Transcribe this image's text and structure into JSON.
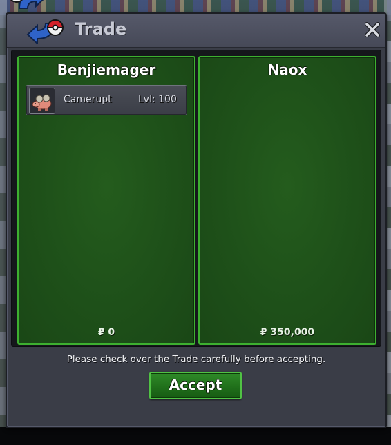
{
  "window": {
    "title": "Trade",
    "close_symbol": "✕"
  },
  "icons": {
    "trade": "trade-swap-pokeball-icon",
    "close": "close-icon",
    "currency": "pokedollar-icon",
    "portrait": "camerupt-portrait-icon"
  },
  "left_panel": {
    "player_name": "Benjiemager",
    "items": [
      {
        "name": "Camerupt",
        "level": "Lvl: 100"
      }
    ],
    "money": "₽ 0"
  },
  "right_panel": {
    "player_name": "Naox",
    "items": [],
    "money": "₽ 350,000"
  },
  "footer": {
    "notice": "Please check over the Trade carefully before accepting.",
    "accept_label": "Accept"
  },
  "colors": {
    "panel_green": "#1e5019",
    "panel_border": "#3db030",
    "window_bg": "#3a3d47",
    "button_green": "#1f6e1a"
  }
}
